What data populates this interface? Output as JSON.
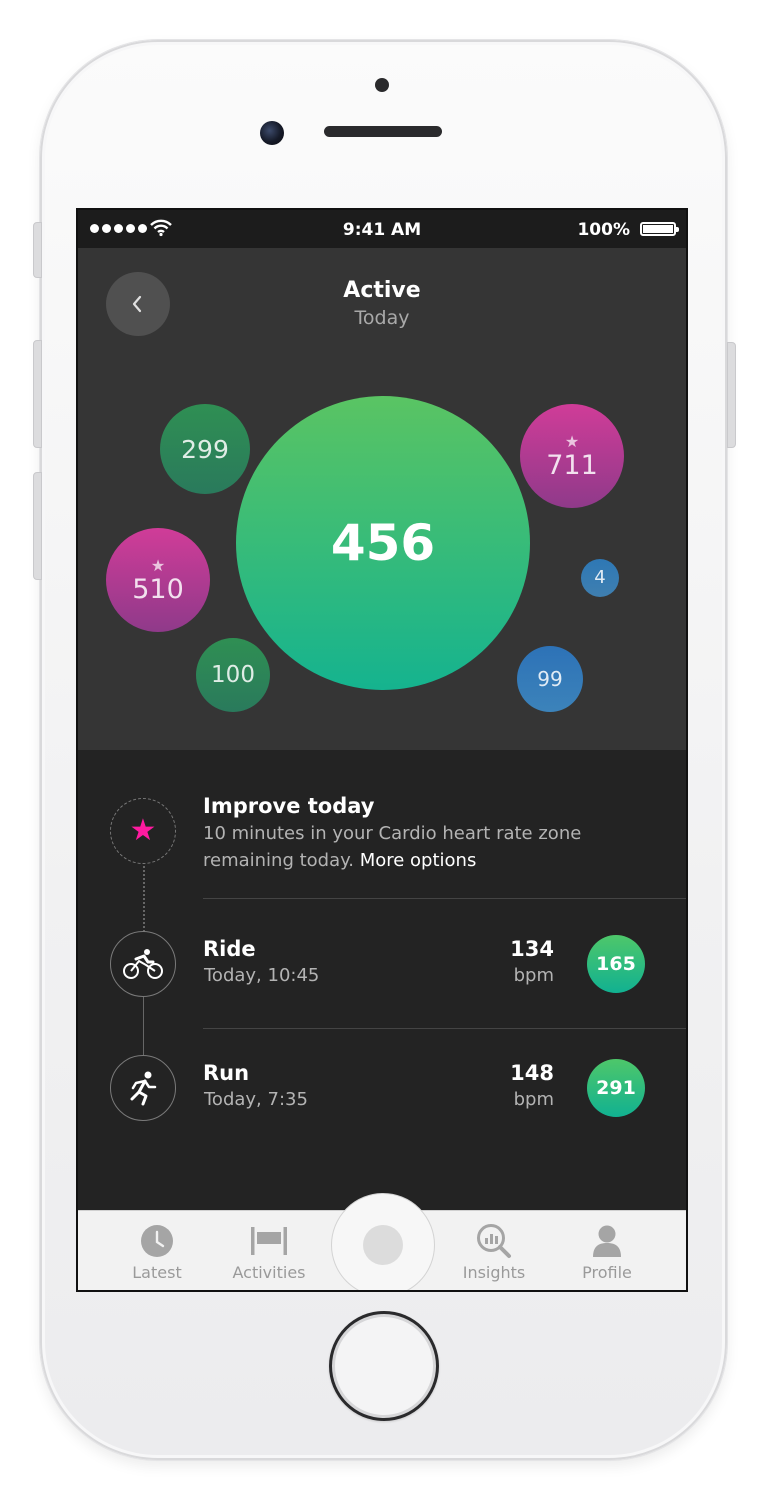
{
  "status_bar": {
    "time": "9:41 AM",
    "battery": "100%"
  },
  "header": {
    "title": "Active",
    "subtitle": "Today"
  },
  "bubbles": {
    "main": "456",
    "b299": "299",
    "b711": "711",
    "b510": "510",
    "b4": "4",
    "b100": "100",
    "b99": "99"
  },
  "improve": {
    "title": "Improve today",
    "text": "10 minutes in your Cardio heart rate zone remaining today.",
    "link": "More options"
  },
  "activities": [
    {
      "name": "Ride",
      "time": "Today, 10:45",
      "heart_rate": "134",
      "unit": "bpm",
      "score": "165",
      "icon": "cycling-icon"
    },
    {
      "name": "Run",
      "time": "Today, 7:35",
      "heart_rate": "148",
      "unit": "bpm",
      "score": "291",
      "icon": "running-icon"
    }
  ],
  "tabs": [
    {
      "label": "Latest",
      "icon": "clock-icon"
    },
    {
      "label": "Activities",
      "icon": "activities-icon"
    },
    {
      "label": "Insights",
      "icon": "insights-icon"
    },
    {
      "label": "Profile",
      "icon": "profile-icon"
    }
  ],
  "colors": {
    "accent_green": "#2fbe7c",
    "accent_pink": "#c93a95",
    "accent_blue": "#2e78b5",
    "star_pink": "#ff1aa0",
    "screen_bg": "#232323",
    "hero_bg": "#353535"
  }
}
